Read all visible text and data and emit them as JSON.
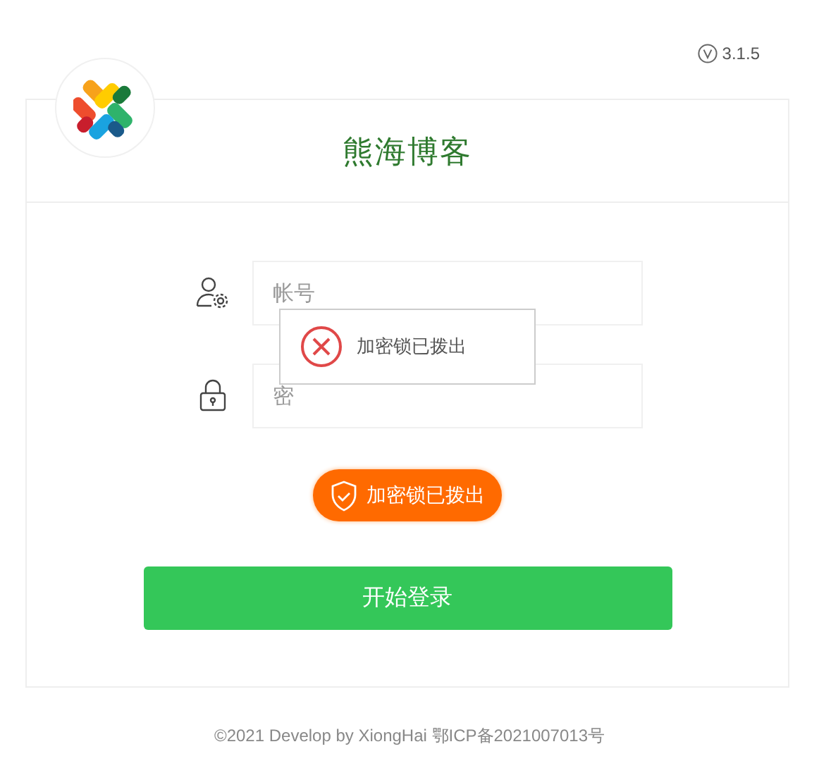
{
  "version": "3.1.5",
  "title": "熊海博客",
  "fields": [
    {
      "kind": "user",
      "placeholder": "帐号"
    },
    {
      "kind": "lock",
      "placeholder": "密"
    }
  ],
  "lock_status": {
    "text": "加密锁已拨出"
  },
  "login_button": "开始登录",
  "toast": {
    "kind": "error",
    "text": "加密锁已拨出"
  },
  "footer": "©2021 Develop by XiongHai 鄂ICP备2021007013号"
}
